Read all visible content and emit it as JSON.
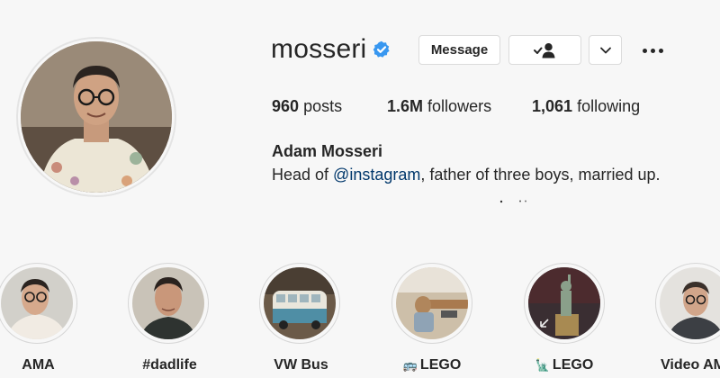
{
  "profile": {
    "username": "mosseri",
    "verified_badge": "verified-check-icon",
    "buttons": {
      "message_label": "Message",
      "follow_icon": "person-check-icon",
      "more_icon": "chevron-down-icon",
      "options_icon": "more-horizontal-icon"
    },
    "stats": {
      "posts_count": "960",
      "posts_label": "posts",
      "followers_count": "1.6M",
      "followers_label": "followers",
      "following_count": "1,061",
      "following_label": "following"
    },
    "full_name": "Adam Mosseri",
    "bio": {
      "before": "Head of ",
      "mention": "@instagram",
      "after": ", father of three boys, married up."
    }
  },
  "highlights": [
    {
      "label": "AMA",
      "emoji": ""
    },
    {
      "label": "#dadlife",
      "emoji": ""
    },
    {
      "label": "VW Bus",
      "emoji": ""
    },
    {
      "label": "LEGO",
      "emoji": "🚌"
    },
    {
      "label": "LEGO",
      "emoji": "🗽"
    },
    {
      "label": "Video AM",
      "emoji": ""
    }
  ],
  "colors": {
    "background": "#f7f7f7",
    "text": "#262626",
    "mention": "#00376b",
    "verified": "#3897f0",
    "border": "#dbdbdb"
  }
}
